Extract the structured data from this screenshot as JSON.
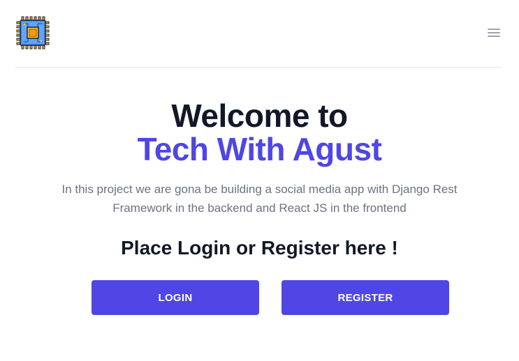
{
  "header": {
    "logo_icon": "microchip-icon",
    "menu_icon": "hamburger-menu-icon"
  },
  "hero": {
    "title_line1": "Welcome to",
    "title_line2": "Tech With Agust",
    "description": "In this project we are gona be building a social media app with Django Rest Framework in the backend and React JS in the frontend",
    "cta_heading": "Place Login or Register here !"
  },
  "buttons": {
    "login_label": "LOGIN",
    "register_label": "REGISTER"
  },
  "colors": {
    "accent": "#4f46e5",
    "heading": "#111827",
    "muted": "#6b7280",
    "divider": "#e5e7eb"
  }
}
